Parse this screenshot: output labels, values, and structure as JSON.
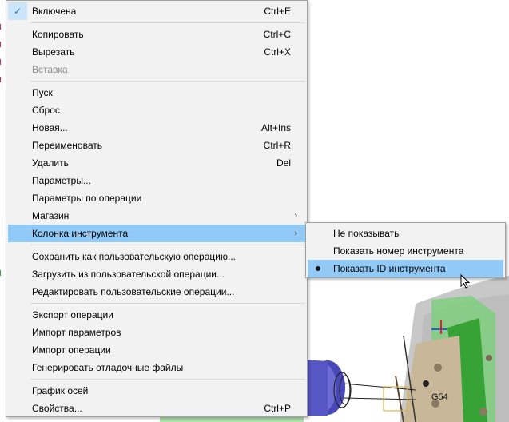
{
  "menu": {
    "items": [
      {
        "label": "Включена",
        "shortcut": "Ctrl+E",
        "checked": true
      },
      {
        "label": "Копировать",
        "shortcut": "Ctrl+C"
      },
      {
        "label": "Вырезать",
        "shortcut": "Ctrl+X"
      },
      {
        "label": "Вставка",
        "shortcut": "",
        "disabled": true
      },
      {
        "label": "Пуск",
        "shortcut": ""
      },
      {
        "label": "Сброс",
        "shortcut": ""
      },
      {
        "label": "Новая...",
        "shortcut": "Alt+Ins"
      },
      {
        "label": "Переименовать",
        "shortcut": "Ctrl+R"
      },
      {
        "label": "Удалить",
        "shortcut": "Del"
      },
      {
        "label": "Параметры...",
        "shortcut": ""
      },
      {
        "label": "Параметры по операции",
        "shortcut": ""
      },
      {
        "label": "Магазин",
        "shortcut": "",
        "submenu": true
      },
      {
        "label": "Колонка инструмента",
        "shortcut": "",
        "submenu": true,
        "highlighted": true
      },
      {
        "label": "Сохранить как пользовательскую операцию...",
        "shortcut": ""
      },
      {
        "label": "Загрузить из пользовательской операции...",
        "shortcut": ""
      },
      {
        "label": "Редактировать пользовательские операции...",
        "shortcut": ""
      },
      {
        "label": "Экспорт операции",
        "shortcut": ""
      },
      {
        "label": "Импорт параметров",
        "shortcut": ""
      },
      {
        "label": "Импорт операции",
        "shortcut": ""
      },
      {
        "label": "Генерировать отладочные файлы",
        "shortcut": ""
      },
      {
        "label": "График осей",
        "shortcut": ""
      },
      {
        "label": "Свойства...",
        "shortcut": "Ctrl+P"
      }
    ]
  },
  "submenu": {
    "items": [
      {
        "label": "Не показывать"
      },
      {
        "label": "Показать номер инструмента"
      },
      {
        "label": "Показать ID инструмента",
        "selected": true
      }
    ]
  },
  "scene": {
    "label": "G54"
  },
  "colors": {
    "highlight": "#91c9f7",
    "menu_bg": "#f2f2f2",
    "check_bg": "#cce4f7",
    "part_green": "#3fae3f"
  },
  "icons": {
    "check": "check-icon",
    "arrow": "chevron-right-icon",
    "bullet": "radio-bullet-icon",
    "cursor": "mouse-cursor-icon"
  }
}
